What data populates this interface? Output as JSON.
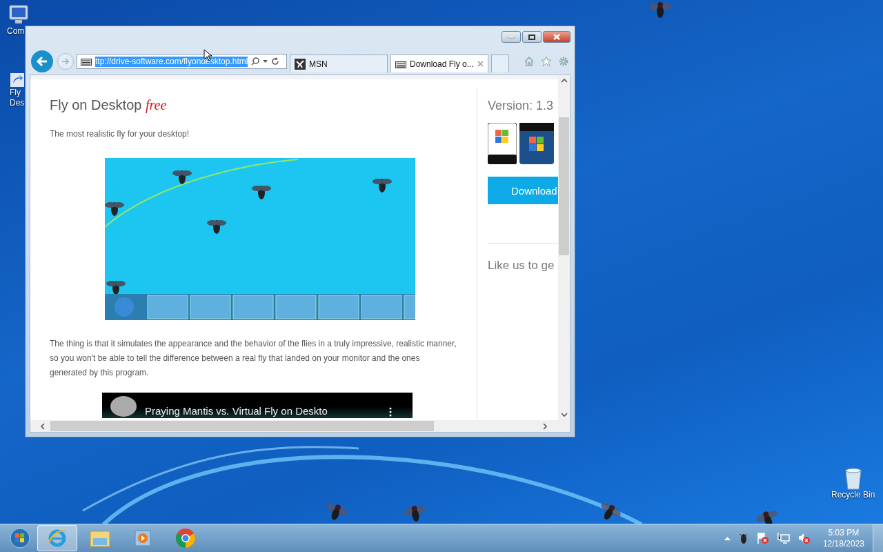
{
  "desktop_icons": [
    {
      "kind": "computer",
      "lines": [
        "Com"
      ]
    },
    {
      "kind": "shortcut",
      "lines": [
        "Fly",
        "Des"
      ]
    }
  ],
  "recycle_bin": {
    "lines": [
      "Recycle Bin"
    ]
  },
  "browser": {
    "address": "ttp://drive-software.com/flyondesktop.html",
    "tabs": [
      {
        "kind": "msn",
        "label": "MSN",
        "selected": false,
        "closable": false
      },
      {
        "kind": "page",
        "label": "Download Fly o...",
        "selected": true,
        "closable": true
      }
    ],
    "page": {
      "title": "Fly on Desktop",
      "title_tag": "free",
      "tagline": "The most realistic fly for your desktop!",
      "paragraph": "The thing is that it simulates the appearance and the behavior of the flies in a truly impressive, realistic manner, so you won't be able to tell the difference between a real fly that landed on your monitor and the ones generated by this program.",
      "video_title": "Praying Mantis vs. Virtual Fly on Deskto",
      "sidebar": {
        "version": "Version: 1.3",
        "download": "Download",
        "like": "Like us to ge"
      }
    }
  },
  "taskbar": {
    "items": [
      {
        "kind": "ie",
        "selected": true
      },
      {
        "kind": "explorer",
        "selected": false
      },
      {
        "kind": "media",
        "selected": false
      },
      {
        "kind": "chrome",
        "selected": false
      }
    ],
    "time": "5:03 PM",
    "date": "12/18/2023"
  }
}
